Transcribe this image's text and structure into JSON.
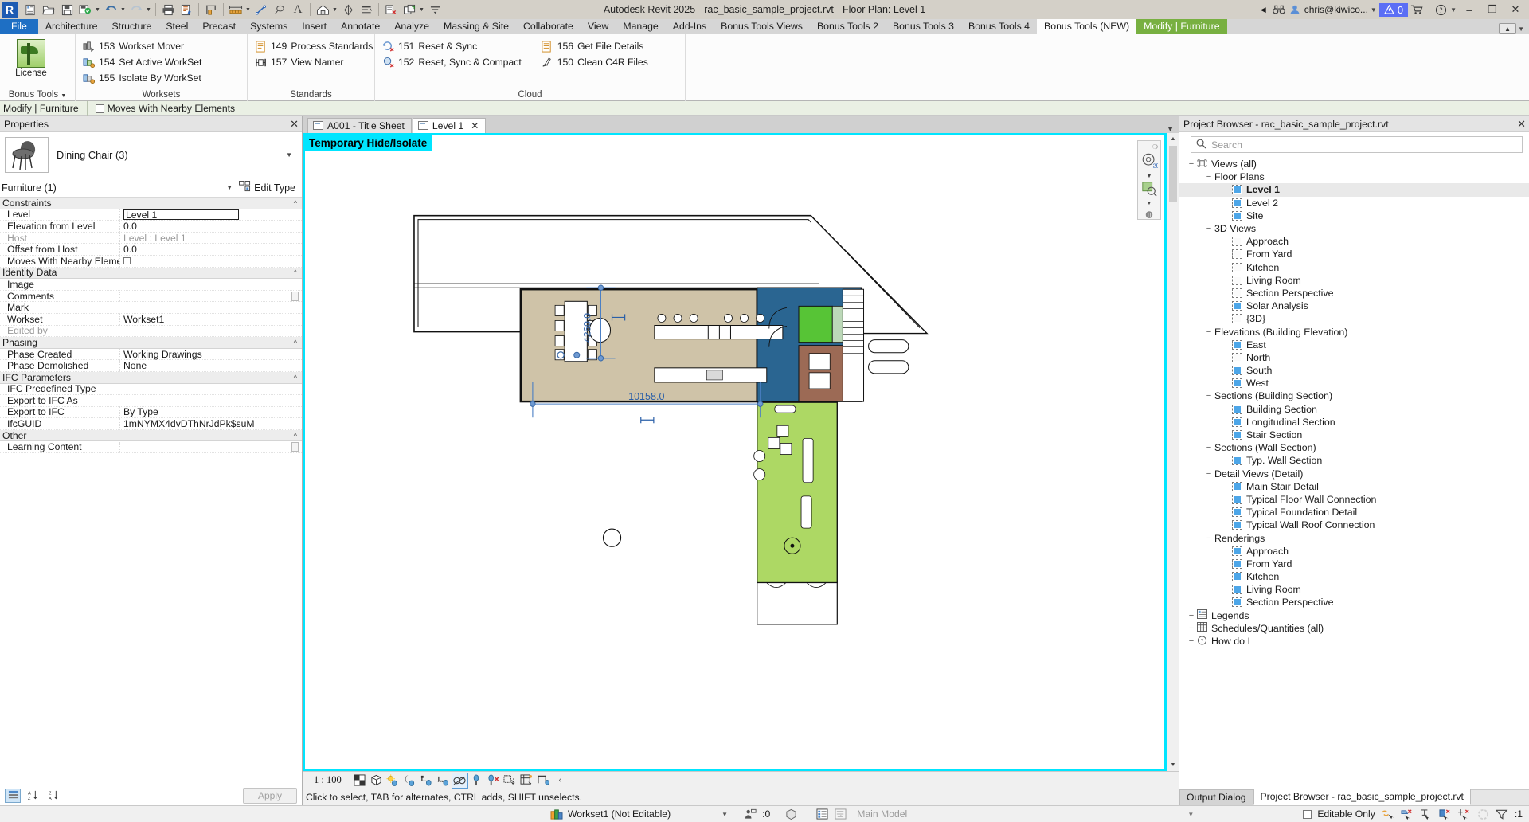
{
  "window": {
    "title": "Autodesk Revit 2025 - rac_basic_sample_project.rvt - Floor Plan: Level 1",
    "user": "chris@kiwico...",
    "warning_count": "0",
    "minimize": "–",
    "restore": "❐",
    "close": "✕"
  },
  "quick_access": {
    "icons": [
      "revit-logo",
      "open-project-sheet",
      "open-folder",
      "save",
      "save-as-cloud",
      "undo",
      "redo",
      "print",
      "print-preview",
      "measure",
      "aligned-dimension",
      "detail-line",
      "tag",
      "text",
      "default-3d-view",
      "section",
      "thin-lines",
      "close-inactive-views",
      "switch-windows",
      "customize-qat"
    ]
  },
  "tabs": [
    {
      "label": "File",
      "kind": "file"
    },
    {
      "label": "Architecture",
      "kind": "normal"
    },
    {
      "label": "Structure",
      "kind": "normal"
    },
    {
      "label": "Steel",
      "kind": "normal"
    },
    {
      "label": "Precast",
      "kind": "normal"
    },
    {
      "label": "Systems",
      "kind": "normal"
    },
    {
      "label": "Insert",
      "kind": "normal"
    },
    {
      "label": "Annotate",
      "kind": "normal"
    },
    {
      "label": "Analyze",
      "kind": "normal"
    },
    {
      "label": "Massing & Site",
      "kind": "normal"
    },
    {
      "label": "Collaborate",
      "kind": "normal"
    },
    {
      "label": "View",
      "kind": "normal"
    },
    {
      "label": "Manage",
      "kind": "normal"
    },
    {
      "label": "Add-Ins",
      "kind": "normal"
    },
    {
      "label": "Bonus Tools Views",
      "kind": "normal"
    },
    {
      "label": "Bonus Tools 2",
      "kind": "normal"
    },
    {
      "label": "Bonus Tools 3",
      "kind": "normal"
    },
    {
      "label": "Bonus Tools 4",
      "kind": "normal"
    },
    {
      "label": "Bonus Tools (NEW)",
      "kind": "active"
    },
    {
      "label": "Modify | Furniture",
      "kind": "context"
    }
  ],
  "ribbon": {
    "license_button": "License",
    "bonus_tools_dropdown": "Bonus Tools",
    "panels": [
      {
        "title": "Worksets",
        "commands": [
          {
            "num": "153",
            "label": "Workset  Mover",
            "icon": "workset-mover-icon"
          },
          {
            "num": "154",
            "label": "Set  Active WorkSet",
            "icon": "set-active-workset-icon"
          },
          {
            "num": "155",
            "label": "Isolate  By WorkSet",
            "icon": "isolate-by-workset-icon"
          }
        ]
      },
      {
        "title": "Standards",
        "commands": [
          {
            "num": "149",
            "label": "Process  Standards",
            "icon": "process-standards-icon"
          },
          {
            "num": "157",
            "label": "View  Namer",
            "icon": "view-namer-icon"
          }
        ]
      },
      {
        "title": "Cloud",
        "commands": [
          {
            "num": "151",
            "label": "Reset  & Sync",
            "icon": "reset-sync-icon"
          },
          {
            "num": "152",
            "label": "Reset,  Sync & Compact",
            "icon": "reset-sync-compact-icon"
          },
          {
            "num": "156",
            "label": "Get  File Details",
            "icon": "get-file-details-icon"
          },
          {
            "num": "150",
            "label": "Clean  C4R Files",
            "icon": "clean-c4r-icon"
          }
        ]
      }
    ]
  },
  "options_bar": {
    "context_label": "Modify | Furniture",
    "checkbox_label": "Moves With Nearby Elements",
    "checked": false
  },
  "properties": {
    "panel_title": "Properties",
    "type_name": "Dining Chair (3)",
    "thumbnail": "dining-chair-thumbnail",
    "filter": "Furniture (1)",
    "edit_type": "Edit Type",
    "apply": "Apply",
    "groups": [
      {
        "name": "Constraints",
        "rows": [
          {
            "key": "Level",
            "value": "Level 1",
            "style": "input"
          },
          {
            "key": "Elevation from Level",
            "value": "0.0",
            "style": "text"
          },
          {
            "key": "Host",
            "value": "Level : Level 1",
            "style": "readonly"
          },
          {
            "key": "Offset from Host",
            "value": "0.0",
            "style": "text"
          },
          {
            "key": "Moves With Nearby Elements",
            "value": "",
            "style": "checkbox"
          }
        ]
      },
      {
        "name": "Identity Data",
        "rows": [
          {
            "key": "Image",
            "value": "",
            "style": "text"
          },
          {
            "key": "Comments",
            "value": "",
            "style": "button"
          },
          {
            "key": "Mark",
            "value": "",
            "style": "text"
          },
          {
            "key": "Workset",
            "value": "Workset1",
            "style": "text"
          },
          {
            "key": "Edited by",
            "value": "",
            "style": "readonly"
          }
        ]
      },
      {
        "name": "Phasing",
        "rows": [
          {
            "key": "Phase Created",
            "value": "Working Drawings",
            "style": "text"
          },
          {
            "key": "Phase Demolished",
            "value": "None",
            "style": "text"
          }
        ]
      },
      {
        "name": "IFC Parameters",
        "rows": [
          {
            "key": "IFC Predefined Type",
            "value": "",
            "style": "text"
          },
          {
            "key": "Export to IFC As",
            "value": "",
            "style": "text"
          },
          {
            "key": "Export to IFC",
            "value": "By Type",
            "style": "text"
          },
          {
            "key": "IfcGUID",
            "value": "1mNYMX4dvDThNrJdPk$suM",
            "style": "text"
          }
        ]
      },
      {
        "name": "Other",
        "rows": [
          {
            "key": "Learning Content",
            "value": "",
            "style": "button"
          }
        ]
      }
    ]
  },
  "view_tabs": [
    {
      "label": "A001 - Title Sheet",
      "active": false,
      "closable": false
    },
    {
      "label": "Level 1",
      "active": true,
      "closable": true
    }
  ],
  "canvas": {
    "banner": "Temporary Hide/Isolate",
    "dimension_vertical": "4260.0",
    "dimension_horizontal": "10158.0",
    "navcube_2d": "2D"
  },
  "view_control_bar": {
    "scale": "1 : 100",
    "icons": [
      "detail-level-icon",
      "visual-style-icon",
      "sun-path-icon",
      "shadows-icon",
      "render-dialog-icon",
      "crop-view-icon",
      "show-crop-icon",
      "temporary-hide-isolate-icon",
      "reveal-hidden-icon",
      "analytical-model-icon",
      "highlight-displacement-icon",
      "constraints-icon",
      "measure-icon",
      "expand-icon"
    ]
  },
  "view_status": {
    "message": "Click to select, TAB for alternates, CTRL adds, SHIFT unselects."
  },
  "project_browser": {
    "title": "Project Browser - rac_basic_sample_project.rvt",
    "search_placeholder": "Search",
    "tree": [
      {
        "label": "Views (all)",
        "depth": 0,
        "type": "root",
        "expander": "−"
      },
      {
        "label": "Floor Plans",
        "depth": 1,
        "type": "group",
        "expander": "−"
      },
      {
        "label": "Level 1",
        "depth": 2,
        "type": "view",
        "filled": true,
        "selected": true
      },
      {
        "label": "Level 2",
        "depth": 2,
        "type": "view",
        "filled": true
      },
      {
        "label": "Site",
        "depth": 2,
        "type": "view",
        "filled": true
      },
      {
        "label": "3D Views",
        "depth": 1,
        "type": "group",
        "expander": "−"
      },
      {
        "label": "Approach",
        "depth": 2,
        "type": "view",
        "filled": false
      },
      {
        "label": "From Yard",
        "depth": 2,
        "type": "view",
        "filled": false
      },
      {
        "label": "Kitchen",
        "depth": 2,
        "type": "view",
        "filled": false
      },
      {
        "label": "Living Room",
        "depth": 2,
        "type": "view",
        "filled": false
      },
      {
        "label": "Section Perspective",
        "depth": 2,
        "type": "view",
        "filled": false
      },
      {
        "label": "Solar Analysis",
        "depth": 2,
        "type": "view",
        "filled": true
      },
      {
        "label": "{3D}",
        "depth": 2,
        "type": "view",
        "filled": false
      },
      {
        "label": "Elevations (Building Elevation)",
        "depth": 1,
        "type": "group",
        "expander": "−"
      },
      {
        "label": "East",
        "depth": 2,
        "type": "view",
        "filled": true
      },
      {
        "label": "North",
        "depth": 2,
        "type": "view",
        "filled": false
      },
      {
        "label": "South",
        "depth": 2,
        "type": "view",
        "filled": true
      },
      {
        "label": "West",
        "depth": 2,
        "type": "view",
        "filled": true
      },
      {
        "label": "Sections (Building Section)",
        "depth": 1,
        "type": "group",
        "expander": "−"
      },
      {
        "label": "Building Section",
        "depth": 2,
        "type": "view",
        "filled": true
      },
      {
        "label": "Longitudinal Section",
        "depth": 2,
        "type": "view",
        "filled": true
      },
      {
        "label": "Stair Section",
        "depth": 2,
        "type": "view",
        "filled": true
      },
      {
        "label": "Sections (Wall Section)",
        "depth": 1,
        "type": "group",
        "expander": "−"
      },
      {
        "label": "Typ. Wall Section",
        "depth": 2,
        "type": "view",
        "filled": true
      },
      {
        "label": "Detail Views (Detail)",
        "depth": 1,
        "type": "group",
        "expander": "−"
      },
      {
        "label": "Main Stair Detail",
        "depth": 2,
        "type": "view",
        "filled": true
      },
      {
        "label": "Typical Floor Wall Connection",
        "depth": 2,
        "type": "view",
        "filled": true
      },
      {
        "label": "Typical Foundation Detail",
        "depth": 2,
        "type": "view",
        "filled": true
      },
      {
        "label": "Typical Wall Roof Connection",
        "depth": 2,
        "type": "view",
        "filled": true
      },
      {
        "label": "Renderings",
        "depth": 1,
        "type": "group",
        "expander": "−"
      },
      {
        "label": "Approach",
        "depth": 2,
        "type": "view",
        "filled": true
      },
      {
        "label": "From Yard",
        "depth": 2,
        "type": "view",
        "filled": true
      },
      {
        "label": "Kitchen",
        "depth": 2,
        "type": "view",
        "filled": true
      },
      {
        "label": "Living Room",
        "depth": 2,
        "type": "view",
        "filled": true
      },
      {
        "label": "Section Perspective",
        "depth": 2,
        "type": "view",
        "filled": true
      },
      {
        "label": "Legends",
        "depth": 0,
        "type": "root",
        "expander": "−"
      },
      {
        "label": "Schedules/Quantities (all)",
        "depth": 0,
        "type": "root",
        "expander": "−"
      },
      {
        "label": "How do I",
        "depth": 0,
        "type": "root",
        "expander": "−"
      }
    ],
    "bottom_tabs": [
      {
        "label": "Output Dialog",
        "active": false
      },
      {
        "label": "Project Browser - rac_basic_sample_project.rvt",
        "active": true
      }
    ]
  },
  "global_status": {
    "workset": "Workset1 (Not Editable)",
    "editing_requests": ":0",
    "design_option": "Main Model",
    "editable_only": "Editable Only",
    "filter_count": ":1"
  },
  "colors": {
    "accent_cyan": "#00e5ff",
    "file_tab_blue": "#1e6fc4",
    "context_tab_green": "#78b041",
    "warning_badge": "#5b6ef5",
    "room_dining": "#cfc3a8",
    "room_blue": "#2a6591",
    "room_green": "#9fd24a",
    "room_brown": "#9c6a55",
    "room_kitchen_green": "#57c436",
    "dimension_blue": "#2a5fa8"
  }
}
